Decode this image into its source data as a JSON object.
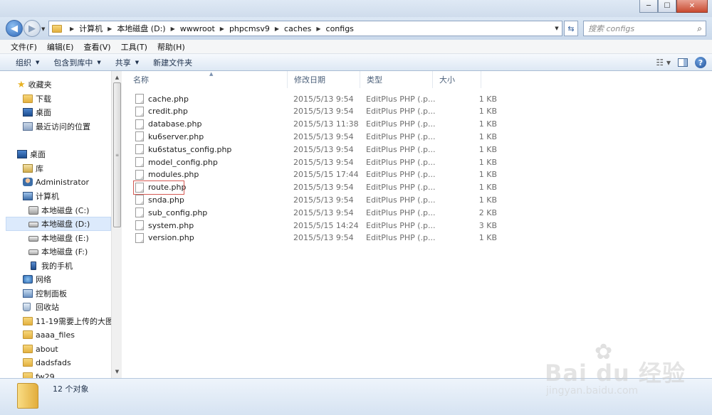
{
  "window": {
    "minimize": "─",
    "maximize": "☐",
    "close": "✕"
  },
  "address": {
    "crumbs": [
      "计算机",
      "本地磁盘 (D:)",
      "wwwroot",
      "phpcmsv9",
      "caches",
      "configs"
    ],
    "search_placeholder": "搜索 configs"
  },
  "menu": [
    "文件(F)",
    "编辑(E)",
    "查看(V)",
    "工具(T)",
    "帮助(H)"
  ],
  "toolbar": {
    "organize": "组织",
    "include": "包含到库中",
    "share": "共享",
    "new_folder": "新建文件夹"
  },
  "nav": {
    "favorites": "收藏夹",
    "downloads": "下载",
    "desktop_fav": "桌面",
    "recent": "最近访问的位置",
    "desktop": "桌面",
    "libraries": "库",
    "admin": "Administrator",
    "computer": "计算机",
    "drive_c": "本地磁盘 (C:)",
    "drive_d": "本地磁盘 (D:)",
    "drive_e": "本地磁盘 (E:)",
    "drive_f": "本地磁盘 (F:)",
    "phone": "我的手机",
    "network": "网络",
    "control_panel": "控制面板",
    "recycle": "回收站",
    "folder1": "11-19需要上传的大图",
    "folder2": "aaaa_files",
    "folder3": "about",
    "folder4": "dadsfads",
    "folder5": "fw29"
  },
  "columns": {
    "name": "名称",
    "date": "修改日期",
    "type": "类型",
    "size": "大小"
  },
  "files": [
    {
      "name": "cache.php",
      "date": "2015/5/13 9:54",
      "type": "EditPlus PHP (.p...",
      "size": "1 KB"
    },
    {
      "name": "credit.php",
      "date": "2015/5/13 9:54",
      "type": "EditPlus PHP (.p...",
      "size": "1 KB"
    },
    {
      "name": "database.php",
      "date": "2015/5/13 11:38",
      "type": "EditPlus PHP (.p...",
      "size": "1 KB"
    },
    {
      "name": "ku6server.php",
      "date": "2015/5/13 9:54",
      "type": "EditPlus PHP (.p...",
      "size": "1 KB"
    },
    {
      "name": "ku6status_config.php",
      "date": "2015/5/13 9:54",
      "type": "EditPlus PHP (.p...",
      "size": "1 KB"
    },
    {
      "name": "model_config.php",
      "date": "2015/5/13 9:54",
      "type": "EditPlus PHP (.p...",
      "size": "1 KB"
    },
    {
      "name": "modules.php",
      "date": "2015/5/15 17:44",
      "type": "EditPlus PHP (.p...",
      "size": "1 KB"
    },
    {
      "name": "route.php",
      "date": "2015/5/13 9:54",
      "type": "EditPlus PHP (.p...",
      "size": "1 KB"
    },
    {
      "name": "snda.php",
      "date": "2015/5/13 9:54",
      "type": "EditPlus PHP (.p...",
      "size": "1 KB"
    },
    {
      "name": "sub_config.php",
      "date": "2015/5/13 9:54",
      "type": "EditPlus PHP (.p...",
      "size": "2 KB"
    },
    {
      "name": "system.php",
      "date": "2015/5/15 14:24",
      "type": "EditPlus PHP (.p...",
      "size": "3 KB"
    },
    {
      "name": "version.php",
      "date": "2015/5/13 9:54",
      "type": "EditPlus PHP (.p...",
      "size": "1 KB"
    }
  ],
  "status": {
    "count": "12 个对象"
  },
  "watermark": {
    "brand": "Bai du 经验",
    "url": "jingyan.baidu.com"
  }
}
